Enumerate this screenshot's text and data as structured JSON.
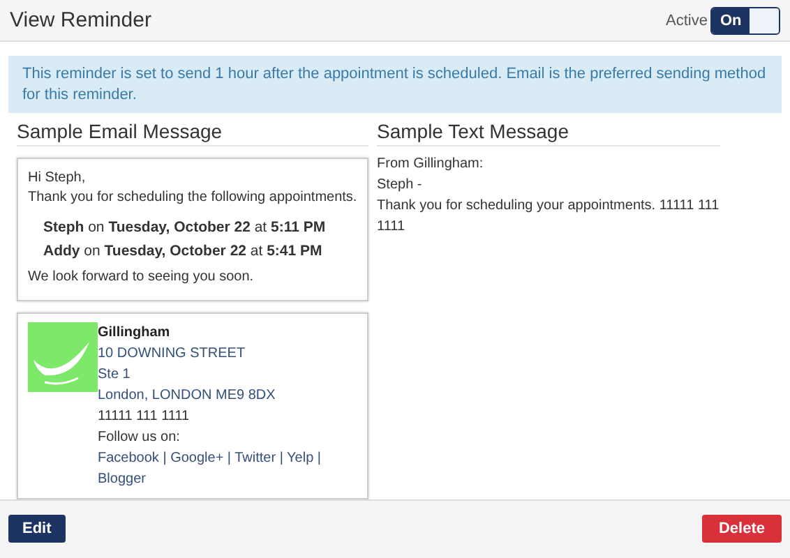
{
  "header": {
    "title": "View Reminder",
    "active_label": "Active",
    "toggle": {
      "label": "On",
      "on": true
    }
  },
  "info": "This reminder is set to send 1 hour after the appointment is scheduled. Email is the preferred sending method for this reminder.",
  "email": {
    "heading": "Sample Email Message",
    "greeting": "Hi Steph,",
    "intro": "Thank you for scheduling the following appointments.",
    "appointments": [
      "**Steph** on **Tuesday, October 22** at **5:11 PM**",
      "**Addy** on **Tuesday, October 22** at **5:41 PM**"
    ],
    "closing": "We look forward to seeing you soon.",
    "signature": {
      "name": "Gillingham",
      "lines": [
        "10 DOWNING STREET",
        "Ste 1",
        "London, LONDON ME9 8DX",
        "11111 111 1111",
        "Follow us on:"
      ],
      "social": "Facebook | Google+ | Twitter | Yelp | Blogger"
    }
  },
  "text": {
    "heading": "Sample Text Message",
    "lines": [
      "From Gillingham:",
      "Steph -",
      "Thank you for scheduling your appointments. 11111 111 1111"
    ]
  },
  "footer": {
    "buttons": [
      {
        "label": "Edit",
        "kind": "primary"
      },
      {
        "label": "Delete",
        "kind": "danger"
      }
    ]
  }
}
